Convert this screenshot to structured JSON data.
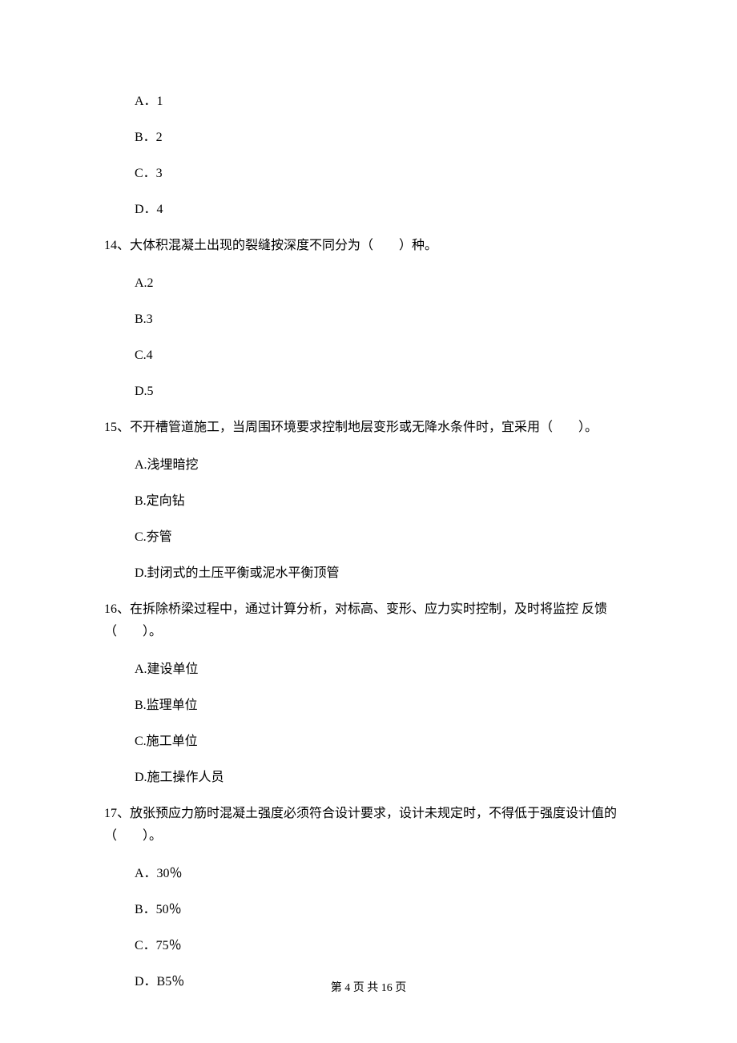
{
  "q13_options": {
    "a": "A．1",
    "b": "B．2",
    "c": "C．3",
    "d": "D．4"
  },
  "q14": {
    "text": "14、大体积混凝土出现的裂缝按深度不同分为（　　）种。",
    "a": "A.2",
    "b": "B.3",
    "c": "C.4",
    "d": "D.5"
  },
  "q15": {
    "text": "15、不开槽管道施工，当周围环境要求控制地层变形或无降水条件时，宜采用（　　）。",
    "a": "A.浅埋暗挖",
    "b": "B.定向钻",
    "c": "C.夯管",
    "d": "D.封闭式的土压平衡或泥水平衡顶管"
  },
  "q16": {
    "text_line1": "16、在拆除桥梁过程中，通过计算分析，对标高、变形、应力实时控制，及时将监控 反馈",
    "text_line2": "（　　）。",
    "a": "A.建设单位",
    "b": "B.监理单位",
    "c": "C.施工单位",
    "d": "D.施工操作人员"
  },
  "q17": {
    "text_line1": "17、放张预应力筋时混凝土强度必须符合设计要求，设计未规定时，不得低于强度设计值的",
    "text_line2": "（　　）。",
    "a": "A．30％",
    "b": "B．50％",
    "c": "C．75％",
    "d": "D．B5％"
  },
  "footer": "第 4 页 共 16 页"
}
